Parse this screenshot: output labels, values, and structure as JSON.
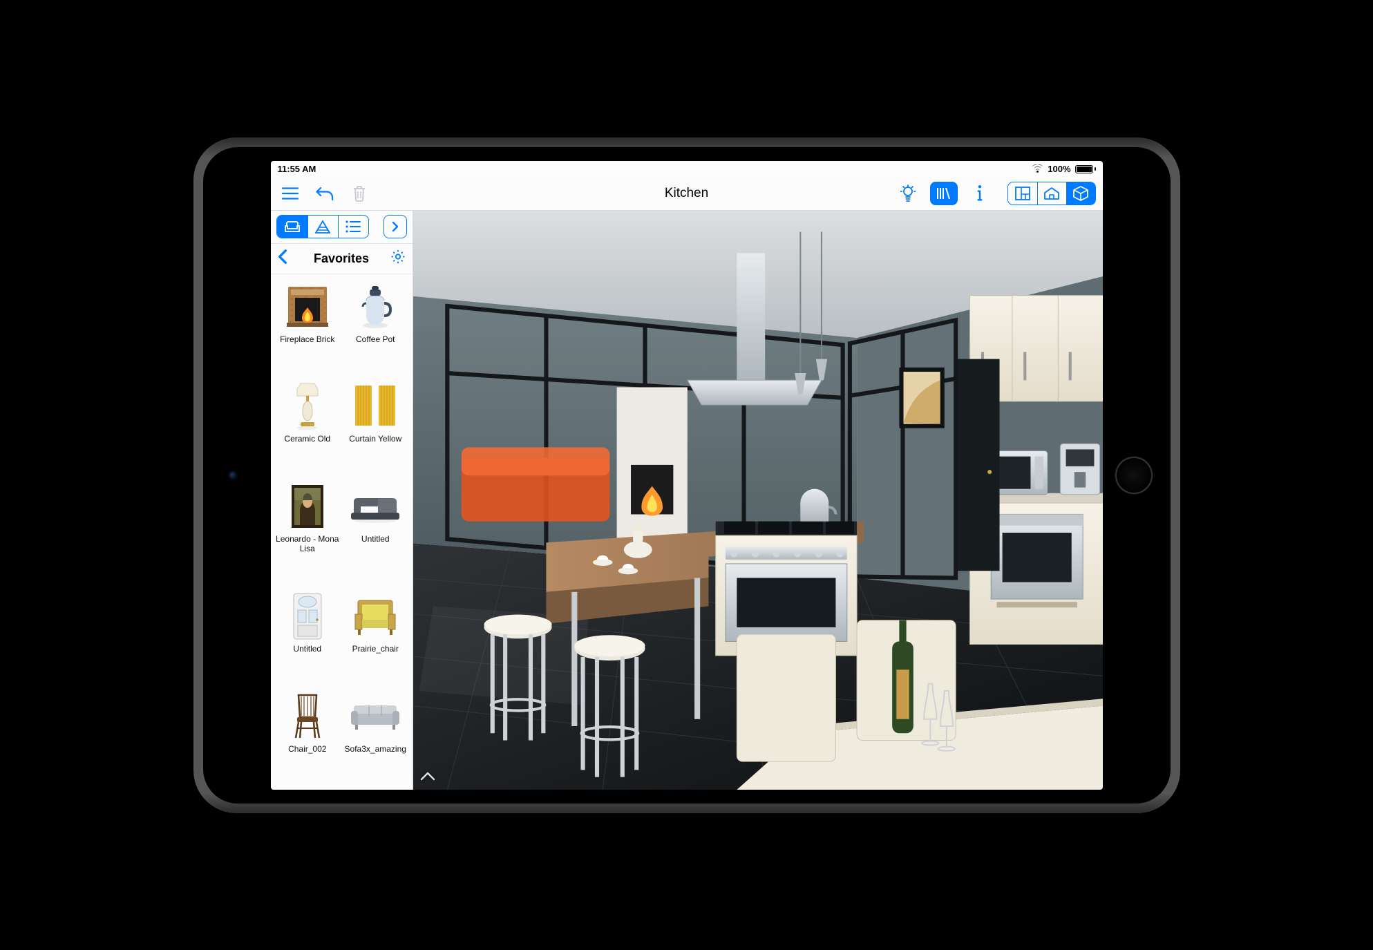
{
  "status": {
    "time": "11:55 AM",
    "battery_pct": "100%"
  },
  "toolbar": {
    "title": "Kitchen"
  },
  "sidebar": {
    "category_title": "Favorites",
    "items": [
      {
        "label": "Fireplace Brick"
      },
      {
        "label": "Coffee Pot"
      },
      {
        "label": "Ceramic Old"
      },
      {
        "label": "Curtain Yellow"
      },
      {
        "label": "Leonardo - Mona Lisa"
      },
      {
        "label": "Untitled"
      },
      {
        "label": "Untitled"
      },
      {
        "label": "Prairie_chair"
      },
      {
        "label": "Chair_002"
      },
      {
        "label": "Sofa3x_amazing"
      }
    ]
  }
}
